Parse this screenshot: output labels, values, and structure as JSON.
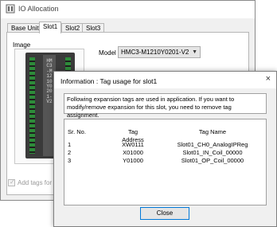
{
  "main_window": {
    "title": "IO Allocation",
    "tabs": [
      {
        "label": "Base Unit"
      },
      {
        "label": "Slot1"
      },
      {
        "label": "Slot2"
      },
      {
        "label": "Slot3"
      }
    ],
    "image_label": "Image",
    "device_label": "HMC3-M1210Y0201-V2",
    "model_label": "Model",
    "model_value": "HMC3-M1210Y0201-V2",
    "add_tags_label": "Add tags for XI/"
  },
  "dialog": {
    "title": "Information : Tag usage for slot1",
    "close_glyph": "×",
    "message": "Following expansion tags are used in application. If you want to modify/remove expansion for this slot, you need to remove tag assignment.",
    "columns": {
      "sr": "Sr. No.",
      "address": "Tag Address",
      "name": "Tag Name"
    },
    "rows": [
      {
        "sr": "1",
        "address": "XW0111",
        "name": "Slot01_CH0_AnalogIPReg"
      },
      {
        "sr": "2",
        "address": "X01000",
        "name": "Slot01_IN_Coil_00000"
      },
      {
        "sr": "3",
        "address": "Y01000",
        "name": "Slot01_OP_Coil_00000"
      }
    ],
    "close_button": "Close"
  },
  "colors": {
    "accent": "#0078d7",
    "terminal_green": "#2e8b3a",
    "window_bg": "#f0f0f0"
  },
  "icons": {
    "app": "io-app-icon",
    "combo": "chevron-down-icon",
    "close": "close-icon"
  }
}
